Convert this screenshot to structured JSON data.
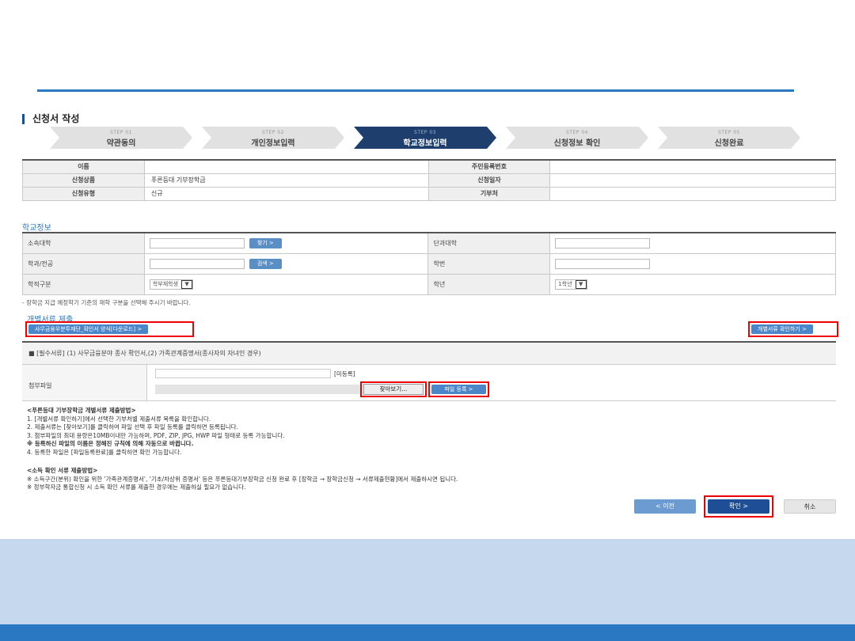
{
  "section_title": "신청서 작성",
  "steps": [
    {
      "num": "STEP 01",
      "label": "약관동의"
    },
    {
      "num": "STEP 02",
      "label": "개인정보입력"
    },
    {
      "num": "STEP 03",
      "label": "학교정보입력"
    },
    {
      "num": "STEP 04",
      "label": "신청정보 확인"
    },
    {
      "num": "STEP 05",
      "label": "신청완료"
    }
  ],
  "info": {
    "name_label": "이름",
    "name_value": "",
    "rrn_label": "주민등록번호",
    "rrn_value": "",
    "product_label": "신청상품",
    "product_value": "푸른등대 기부장학금",
    "date_label": "신청일자",
    "date_value": "",
    "type_label": "신청유형",
    "type_value": "신규",
    "donor_label": "기부처",
    "donor_value": ""
  },
  "school": {
    "title": "학교정보",
    "univ_label": "소속대학",
    "univ_btn": "찾기 >",
    "college_label": "단과대학",
    "dept_label": "학과/전공",
    "dept_btn": "검색 >",
    "id_label": "학번",
    "status_label": "학적구분",
    "status_value": "학부재학생",
    "grade_label": "학년",
    "grade_value": "1학년"
  },
  "note1": "- 장학금 지급 예정학기 기준의 재학 구분을 선택해 주시기 바랍니다.",
  "docs": {
    "title": "개별서류 제출",
    "download_btn": "사무금융우분투재단_확인서 양식[다운로드] >",
    "check_btn": "개별서류 확인하기 >",
    "item_header": "■ [필수서류] (1) 사무금융분야 종사 확인서,(2) 가족관계증명서(종사자의 자녀인 경우)",
    "attach_label": "첨부파일",
    "file_status": "[미등록]",
    "browse_btn": "찾아보기...",
    "register_btn": "파일 등록 >"
  },
  "instructions": {
    "heading": "<푸른등대 기부장학금 개별서류 제출방법>",
    "lines": [
      "1. [개별서류 확인하기]에서 선택한 기부처별 제출서류 목록을 확인합니다.",
      "2. 제출서류는 [찾아보기]를 클릭하여 파일 선택 후 파일 등록를 클릭하면 등록됩니다.",
      "3. 첨부파일의 최대 용량은10MB이내만 가능하며, PDF, ZIP, JPG, HWP 파일 형태로 등록 가능합니다.",
      "   ※ 등록하신 파일의 이름은 정해진 규칙에 의해 자동으로 바뀝니다.",
      "4. 등록한 파일은 [파일등록완료]를 클릭하면 확인 가능합니다."
    ]
  },
  "income": {
    "heading": "<소득 확인 서류 제출방법>",
    "lines": [
      "※ 소득구간(분위) 확인을 위한 '가족관계증명서', '기초/차상위 증명서' 등은 푸른등대기부장학금 신청 완료 후 [장학금 → 장학금신청 → 서류제출현황]에서 제출하시면 됩니다.",
      "※ 정부학자금 통합신청 시 소득 확인 서류를 제출한 경우에는 제출하실 필요가 없습니다."
    ]
  },
  "buttons": {
    "prev": "< 이전",
    "confirm": "확인 >",
    "cancel": "취소"
  }
}
